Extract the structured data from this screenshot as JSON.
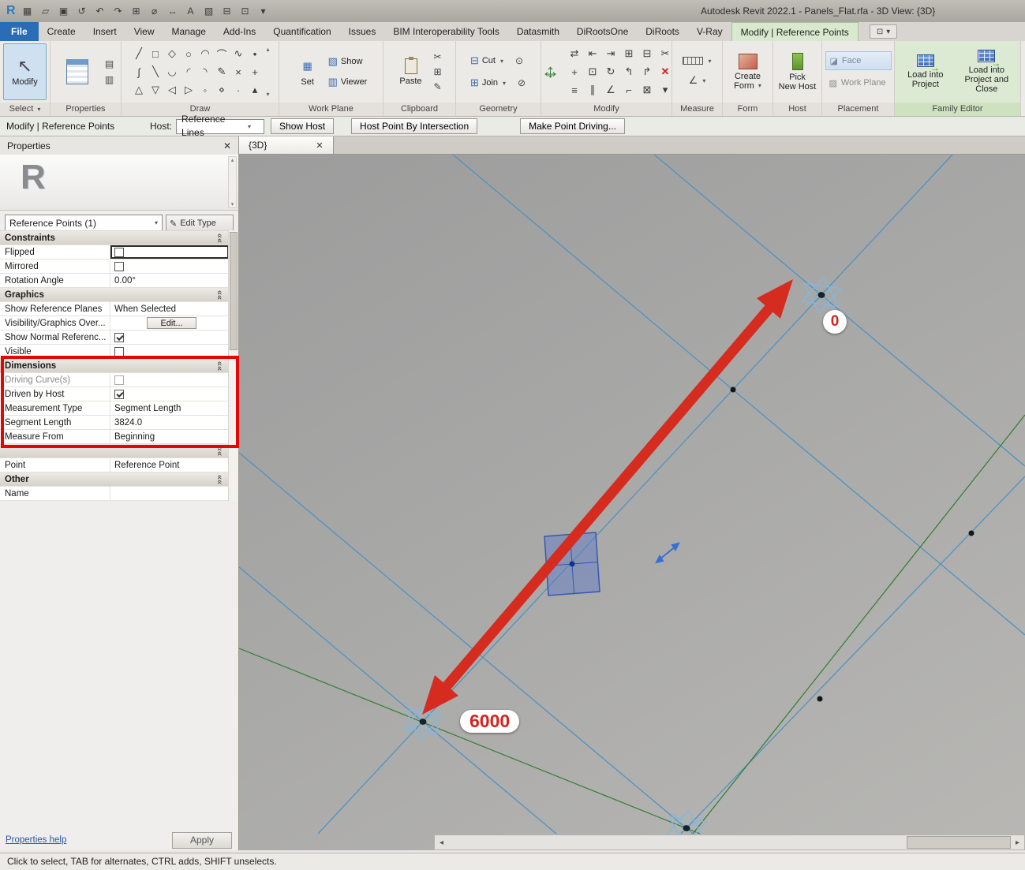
{
  "title_bar": {
    "title": "Autodesk Revit 2022.1 - Panels_Flat.rfa - 3D View: {3D}"
  },
  "ribbon_tabs": {
    "file": "File",
    "items": [
      "Create",
      "Insert",
      "View",
      "Manage",
      "Add-Ins",
      "Quantification",
      "Issues",
      "BIM Interoperability Tools",
      "Datasmith",
      "DiRootsOne",
      "DiRoots",
      "V-Ray"
    ],
    "active": "Modify | Reference Points"
  },
  "ribbon": {
    "select": {
      "modify": "Modify",
      "label": "Select"
    },
    "properties": {
      "label": "Properties"
    },
    "draw": {
      "label": "Draw"
    },
    "work_plane": {
      "set": "Set",
      "show": "Show",
      "viewer": "Viewer",
      "label": "Work Plane"
    },
    "clipboard": {
      "paste": "Paste",
      "label": "Clipboard"
    },
    "geometry": {
      "cut": "Cut",
      "join": "Join",
      "label": "Geometry"
    },
    "modify": {
      "label": "Modify"
    },
    "measure": {
      "label": "Measure"
    },
    "form": {
      "create": "Create",
      "form": "Form",
      "label": "Form"
    },
    "host": {
      "pick": "Pick",
      "new_host": "New Host",
      "label": "Host"
    },
    "placement": {
      "face": "Face",
      "work_plane": "Work Plane",
      "label": "Placement"
    },
    "family_editor": {
      "load_1": "Load into",
      "load_2": "Project",
      "load_close_1": "Load into",
      "load_close_2": "Project and Close",
      "label": "Family Editor"
    }
  },
  "options_bar": {
    "mode": "Modify | Reference Points",
    "host_label": "Host:",
    "host_value": "Reference Lines",
    "show_host": "Show Host",
    "host_point_by_intersection": "Host Point By Intersection",
    "make_point_driving": "Make Point Driving..."
  },
  "properties_palette": {
    "title": "Properties",
    "preview_letter": "R",
    "type_selector": "Reference Points (1)",
    "edit_type": "Edit Type",
    "rows": [
      {
        "label": "Constraints"
      },
      {
        "label": "Flipped",
        "checked": false
      },
      {
        "label": "Mirrored",
        "checked": false
      },
      {
        "label": "Rotation Angle",
        "value": "0.00°"
      },
      {
        "label": "Graphics"
      },
      {
        "label": "Show Reference Planes",
        "value": "When Selected"
      },
      {
        "label": "Visibility/Graphics Over...",
        "value": "Edit..."
      },
      {
        "label": "Show Normal Referenc...",
        "checked": true
      },
      {
        "label": "Visible",
        "checked": false
      },
      {
        "label": "Dimensions"
      },
      {
        "label": "Driving Curve(s)",
        "value": ""
      },
      {
        "label": "Driven by Host",
        "checked": true
      },
      {
        "label": "Measurement Type",
        "value": "Segment Length"
      },
      {
        "label": "Segment Length",
        "value": "3824.0"
      },
      {
        "label": "Measure From",
        "value": "Beginning"
      },
      {
        "label": ""
      },
      {
        "label": "Point",
        "value": "Reference Point"
      },
      {
        "label": "Other"
      },
      {
        "label": "Name",
        "value": ""
      }
    ],
    "help": "Properties help",
    "apply": "Apply"
  },
  "view": {
    "tab": "{3D}",
    "annotation_zero": "0",
    "annotation_six_thousand": "6000",
    "segment_length_shown": "3824.0"
  },
  "status_bar": {
    "hint": "Click to select, TAB for alternates, CTRL adds, SHIFT unselects."
  },
  "colors": {
    "arrow_red": "#d62b1f",
    "highlight_red": "#e60505",
    "grid_blue": "#4f93c1",
    "grid_green": "#2f7d32",
    "active_tab_green": "#d8e9cf",
    "file_tab_blue": "#2a6cb5",
    "annotation_text_red": "#d42421"
  },
  "icons": {
    "revit_logo": "R",
    "qat": [
      "▦",
      "▱",
      "▣",
      "↺",
      "↶",
      "↷",
      "⊞",
      "⌀",
      "↔",
      "A",
      "▧",
      "⊟",
      "⊡",
      "▾"
    ],
    "caret_down": "▾",
    "menu_caret": "▾",
    "close": "✕",
    "collapse_chevron": "««",
    "modify_cursor": "↖",
    "left_arrow": "◂",
    "right_arrow": "▸",
    "up_arrow": "▴",
    "down_arrow": "▾",
    "draw": [
      "╱",
      "□",
      "◇",
      "○",
      "◠",
      "⌒",
      "∿",
      "•",
      "∫",
      "╲",
      "◡",
      "◜",
      "◝",
      "✎",
      "×",
      "+",
      "△",
      "▽",
      "◁",
      "▷",
      "◦",
      "⋄",
      "·",
      "▴"
    ],
    "modify_grid": [
      "⇄",
      "⇤",
      "⇥",
      "⊞",
      "⊟",
      "✂",
      "+",
      "⊡",
      "↻",
      "↰",
      "↱",
      "✕",
      "≡",
      "∥",
      "∠",
      "⌐",
      "⊠",
      "▾"
    ],
    "move_h": "↔",
    "move_v": "↕",
    "prop_small_1": "▤",
    "prop_small_2": "▥",
    "set_icon": "▦",
    "show_icon": "▧",
    "viewer_icon": "▥",
    "scissors": "✂",
    "copy_icon": "⊞",
    "match_icon": "✎",
    "cut_icon": "⊟",
    "join_icon": "⊞",
    "geom_extra1": "⊙",
    "geom_extra2": "⊘",
    "angle_icon": "∠",
    "face_icon": "◪",
    "workplane_icon": "▨",
    "edit_type_icon": "✎",
    "load_arrow": "→"
  }
}
